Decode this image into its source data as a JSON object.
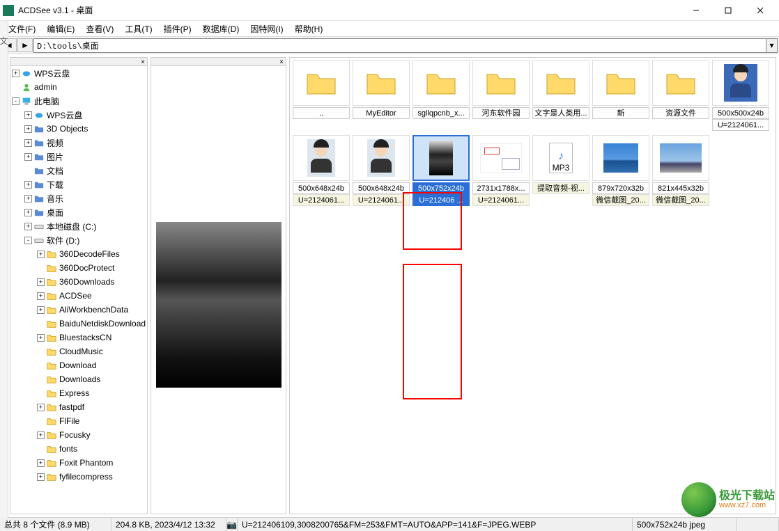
{
  "window": {
    "title": "ACDSee v3.1 - 桌面",
    "min": "–",
    "max": "☐",
    "close": "✕"
  },
  "menu": [
    "文件(F)",
    "编辑(E)",
    "查看(V)",
    "工具(T)",
    "插件(P)",
    "数据库(D)",
    "因特网(I)",
    "帮助(H)"
  ],
  "address": {
    "path": "D:\\tools\\桌面"
  },
  "tree": [
    {
      "d": 0,
      "exp": "+",
      "icon": "cloud",
      "label": "WPS云盘"
    },
    {
      "d": 0,
      "exp": "",
      "icon": "user",
      "label": "admin"
    },
    {
      "d": 0,
      "exp": "-",
      "icon": "pc",
      "label": "此电脑"
    },
    {
      "d": 1,
      "exp": "+",
      "icon": "cloud",
      "label": "WPS云盘"
    },
    {
      "d": 1,
      "exp": "+",
      "icon": "d",
      "label": "3D Objects"
    },
    {
      "d": 1,
      "exp": "+",
      "icon": "d",
      "label": "视频"
    },
    {
      "d": 1,
      "exp": "+",
      "icon": "d",
      "label": "图片"
    },
    {
      "d": 1,
      "exp": "",
      "icon": "d",
      "label": "文档"
    },
    {
      "d": 1,
      "exp": "+",
      "icon": "d",
      "label": "下载"
    },
    {
      "d": 1,
      "exp": "+",
      "icon": "d",
      "label": "音乐"
    },
    {
      "d": 1,
      "exp": "+",
      "icon": "d",
      "label": "桌面"
    },
    {
      "d": 1,
      "exp": "+",
      "icon": "drive",
      "label": "本地磁盘 (C:)"
    },
    {
      "d": 1,
      "exp": "-",
      "icon": "drive",
      "label": "软件 (D:)"
    },
    {
      "d": 2,
      "exp": "+",
      "icon": "folder",
      "label": "360DecodeFiles"
    },
    {
      "d": 2,
      "exp": "",
      "icon": "folder",
      "label": "360DocProtect"
    },
    {
      "d": 2,
      "exp": "+",
      "icon": "folder",
      "label": "360Downloads"
    },
    {
      "d": 2,
      "exp": "+",
      "icon": "folder",
      "label": "ACDSee"
    },
    {
      "d": 2,
      "exp": "+",
      "icon": "folder",
      "label": "AliWorkbenchData"
    },
    {
      "d": 2,
      "exp": "",
      "icon": "folder",
      "label": "BaiduNetdiskDownload"
    },
    {
      "d": 2,
      "exp": "+",
      "icon": "folder",
      "label": "BluestacksCN"
    },
    {
      "d": 2,
      "exp": "",
      "icon": "folder",
      "label": "CloudMusic"
    },
    {
      "d": 2,
      "exp": "",
      "icon": "folder",
      "label": "Download"
    },
    {
      "d": 2,
      "exp": "",
      "icon": "folder",
      "label": "Downloads"
    },
    {
      "d": 2,
      "exp": "",
      "icon": "folder",
      "label": "Express"
    },
    {
      "d": 2,
      "exp": "+",
      "icon": "folder",
      "label": "fastpdf"
    },
    {
      "d": 2,
      "exp": "",
      "icon": "folder",
      "label": "FlFile"
    },
    {
      "d": 2,
      "exp": "+",
      "icon": "folder",
      "label": "Focusky"
    },
    {
      "d": 2,
      "exp": "",
      "icon": "folder",
      "label": "fonts"
    },
    {
      "d": 2,
      "exp": "+",
      "icon": "folder",
      "label": "Foxit Phantom"
    },
    {
      "d": 2,
      "exp": "+",
      "icon": "folder",
      "label": "fyfilecompress"
    }
  ],
  "folders_row": [
    {
      "label": "..",
      "icon": "folder"
    },
    {
      "label": "MyEditor",
      "icon": "folder"
    },
    {
      "label": "sgllqpcnb_x...",
      "icon": "folder"
    },
    {
      "label": "河东软件园",
      "icon": "folder"
    },
    {
      "label": "文字是人类用...",
      "icon": "folder"
    },
    {
      "label": "新",
      "icon": "folder"
    },
    {
      "label": "资源文件",
      "icon": "folder"
    },
    {
      "label": "U=2124061...",
      "icon": "portrait",
      "dim": "500x500x24b"
    }
  ],
  "files_row": [
    {
      "dim": "500x648x24b",
      "name": "U=2124061...",
      "type": "person"
    },
    {
      "dim": "500x648x24b",
      "name": "U=2124061...",
      "type": "person"
    },
    {
      "dim": "500x752x24b",
      "name": "U=212406 ...",
      "type": "bw",
      "selected": true
    },
    {
      "dim": "2731x1788x...",
      "name": "U=2124061...",
      "type": "diagram"
    },
    {
      "dim": "",
      "name": "提取音频-视...",
      "type": "mp3",
      "mp3": "MP3"
    },
    {
      "dim": "879x720x32b",
      "name": "微信截图_20...",
      "type": "bridge"
    },
    {
      "dim": "821x445x32b",
      "name": "微信截图_20...",
      "type": "city"
    }
  ],
  "status": {
    "summary": "总共 8 个文件 (8.9 MB)",
    "filesize": "204.8 KB, 2023/4/12 13:32",
    "filename": "U=212406109,3008200765&FM=253&FMT=AUTO&APP=141&F=JPEG.WEBP",
    "format": "500x752x24b jpeg"
  },
  "logo": {
    "cn": "极光下载站",
    "en": "www.xz7.com"
  }
}
